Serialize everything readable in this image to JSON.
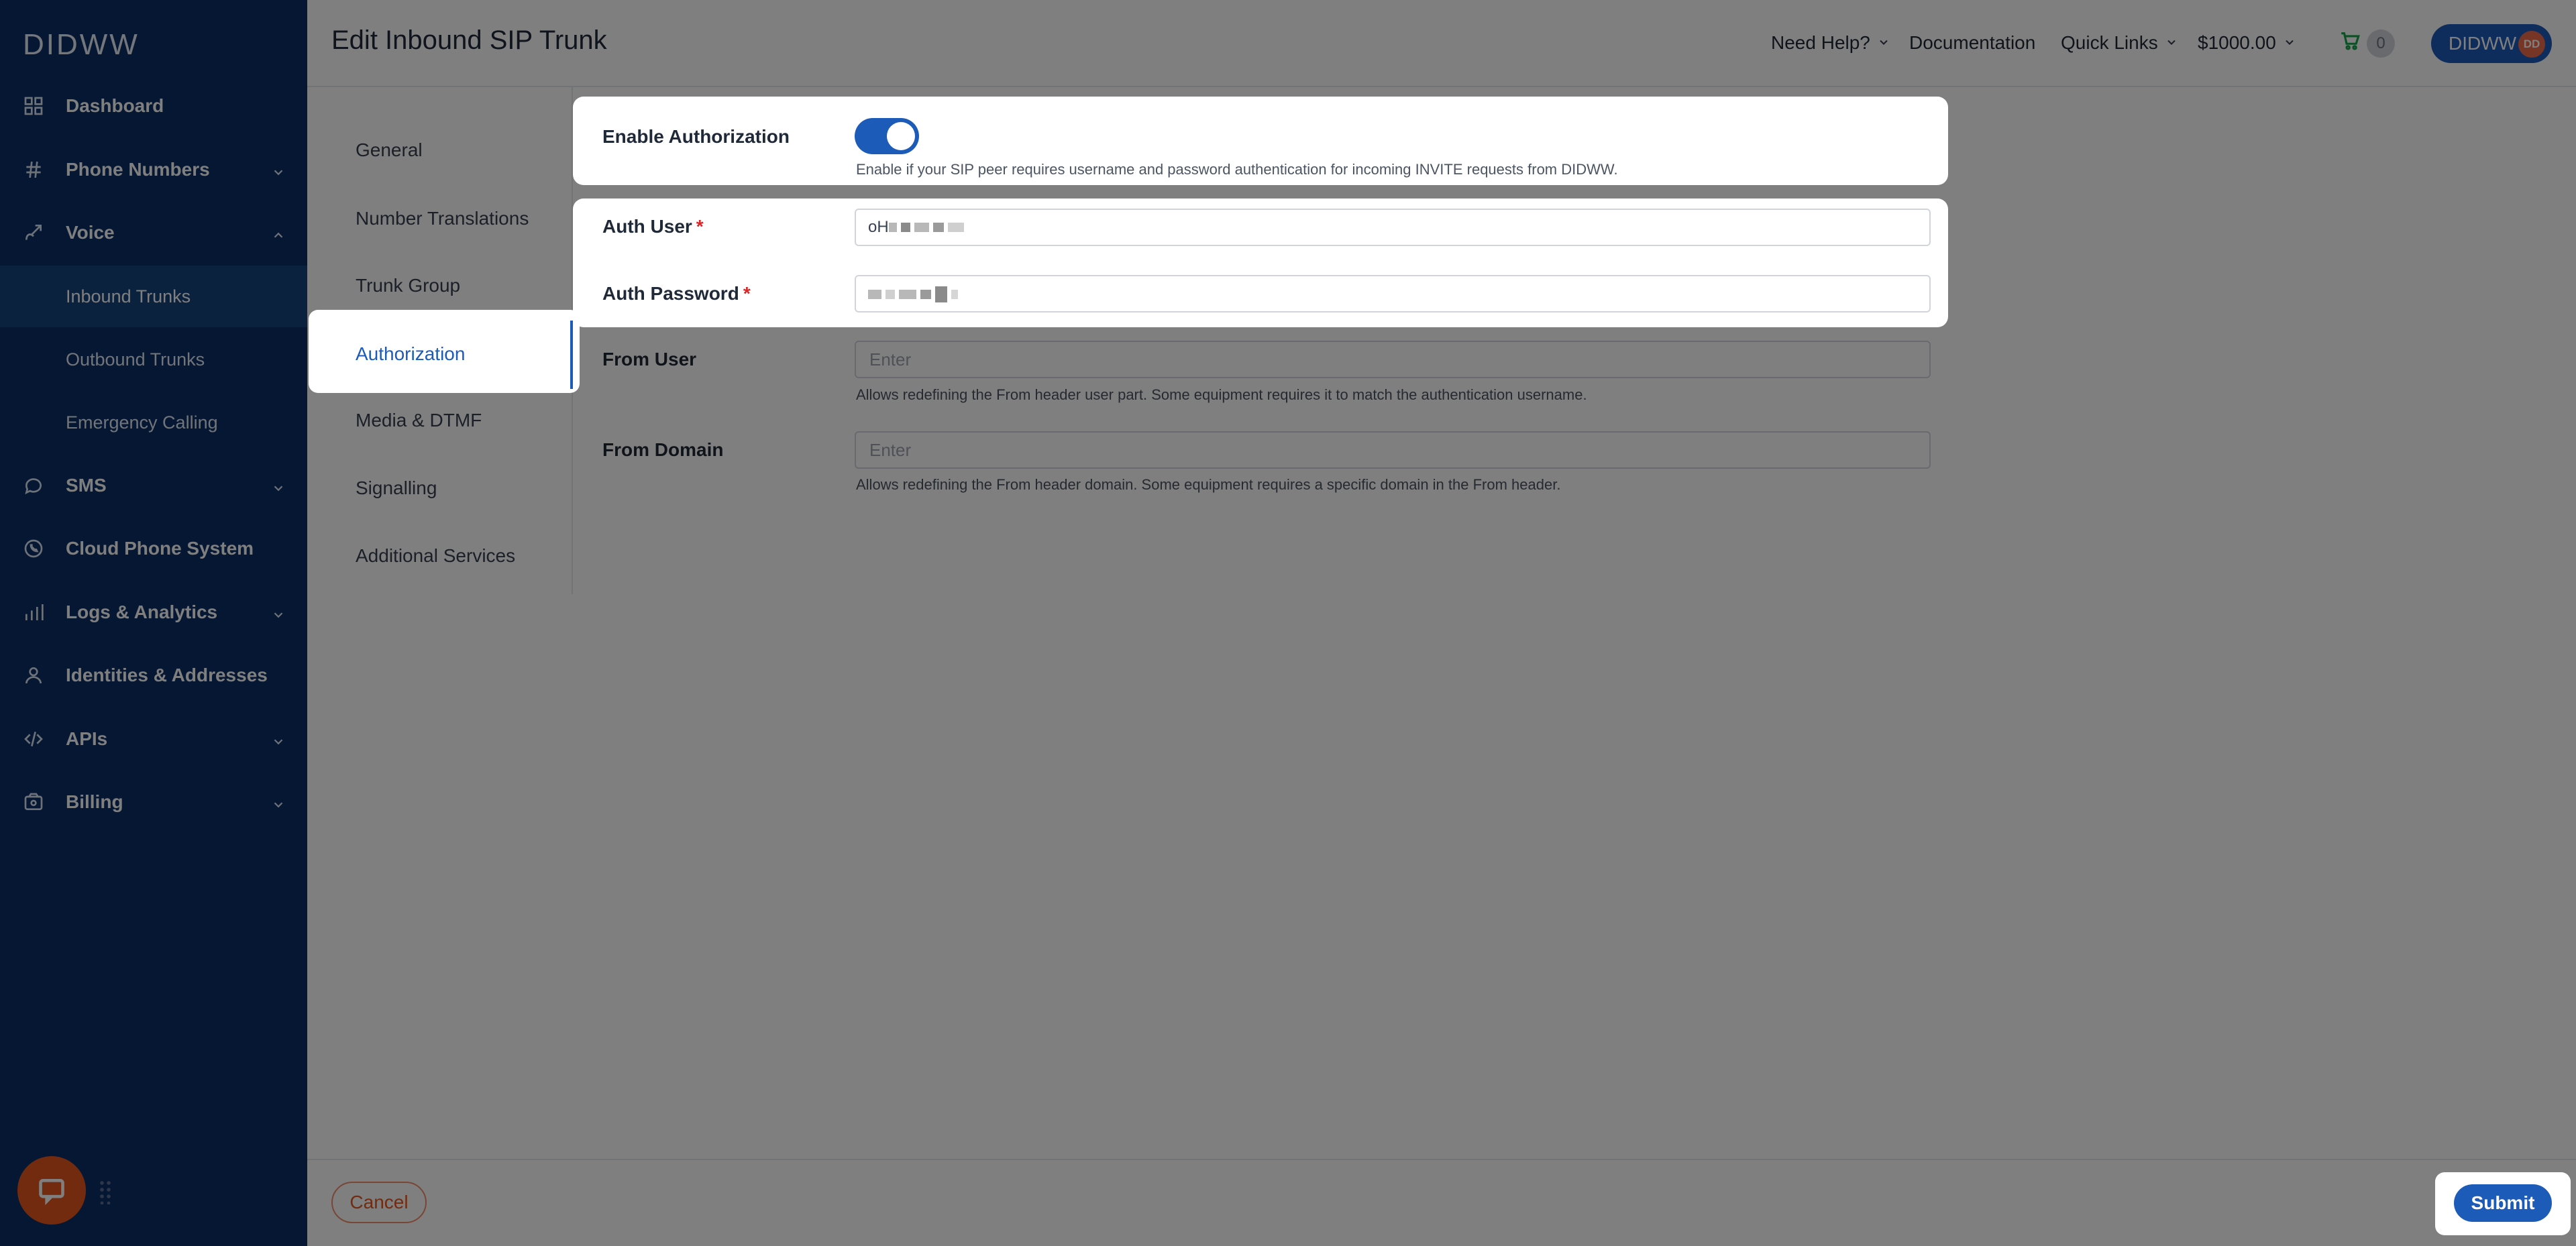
{
  "app": {
    "logo": "DIDWW"
  },
  "sidebar": {
    "items": [
      {
        "label": "Dashboard",
        "icon": "grid-icon"
      },
      {
        "label": "Phone Numbers",
        "icon": "hash-icon"
      },
      {
        "label": "Voice",
        "icon": "call-forward-icon"
      },
      {
        "label": "SMS",
        "icon": "message-icon"
      },
      {
        "label": "Cloud Phone System",
        "icon": "phone-circle-icon"
      },
      {
        "label": "Logs & Analytics",
        "icon": "bar-chart-icon"
      },
      {
        "label": "Identities & Addresses",
        "icon": "user-icon"
      },
      {
        "label": "APIs",
        "icon": "code-icon"
      },
      {
        "label": "Billing",
        "icon": "wallet-icon"
      }
    ],
    "voice_sub": [
      {
        "label": "Inbound Trunks",
        "active": true
      },
      {
        "label": "Outbound Trunks"
      },
      {
        "label": "Emergency Calling"
      }
    ]
  },
  "header": {
    "title": "Edit Inbound SIP Trunk",
    "need_help": "Need Help?",
    "documentation": "Documentation",
    "quick_links": "Quick Links",
    "balance": "$1000.00",
    "cart_count": "0",
    "account": "DIDWW",
    "avatar_initials": "DD"
  },
  "tabs": [
    {
      "label": "General"
    },
    {
      "label": "Number Translations"
    },
    {
      "label": "Trunk Group"
    },
    {
      "label": "Authorization",
      "active": true
    },
    {
      "label": "Media & DTMF"
    },
    {
      "label": "Signalling"
    },
    {
      "label": "Additional Services"
    }
  ],
  "form": {
    "enable_auth": {
      "label": "Enable Authorization",
      "enabled": true,
      "help": "Enable if your SIP peer requires username and password authentication for incoming INVITE requests from DIDWW."
    },
    "auth_user": {
      "label": "Auth User",
      "required_mark": "*",
      "value_prefix": "oH"
    },
    "auth_password": {
      "label": "Auth Password",
      "required_mark": "*"
    },
    "from_user": {
      "label": "From User",
      "placeholder": "Enter",
      "help": "Allows redefining the From header user part. Some equipment requires it to match the authentication username."
    },
    "from_domain": {
      "label": "From Domain",
      "placeholder": "Enter",
      "help": "Allows redefining the From header domain. Some equipment requires a specific domain in the From header."
    }
  },
  "footer": {
    "cancel": "Cancel",
    "submit": "Submit"
  },
  "colors": {
    "sidebar_bg": "#0b2e66",
    "primary": "#1d5bb8",
    "accent_orange": "#e5571f",
    "required": "#dc2626"
  }
}
